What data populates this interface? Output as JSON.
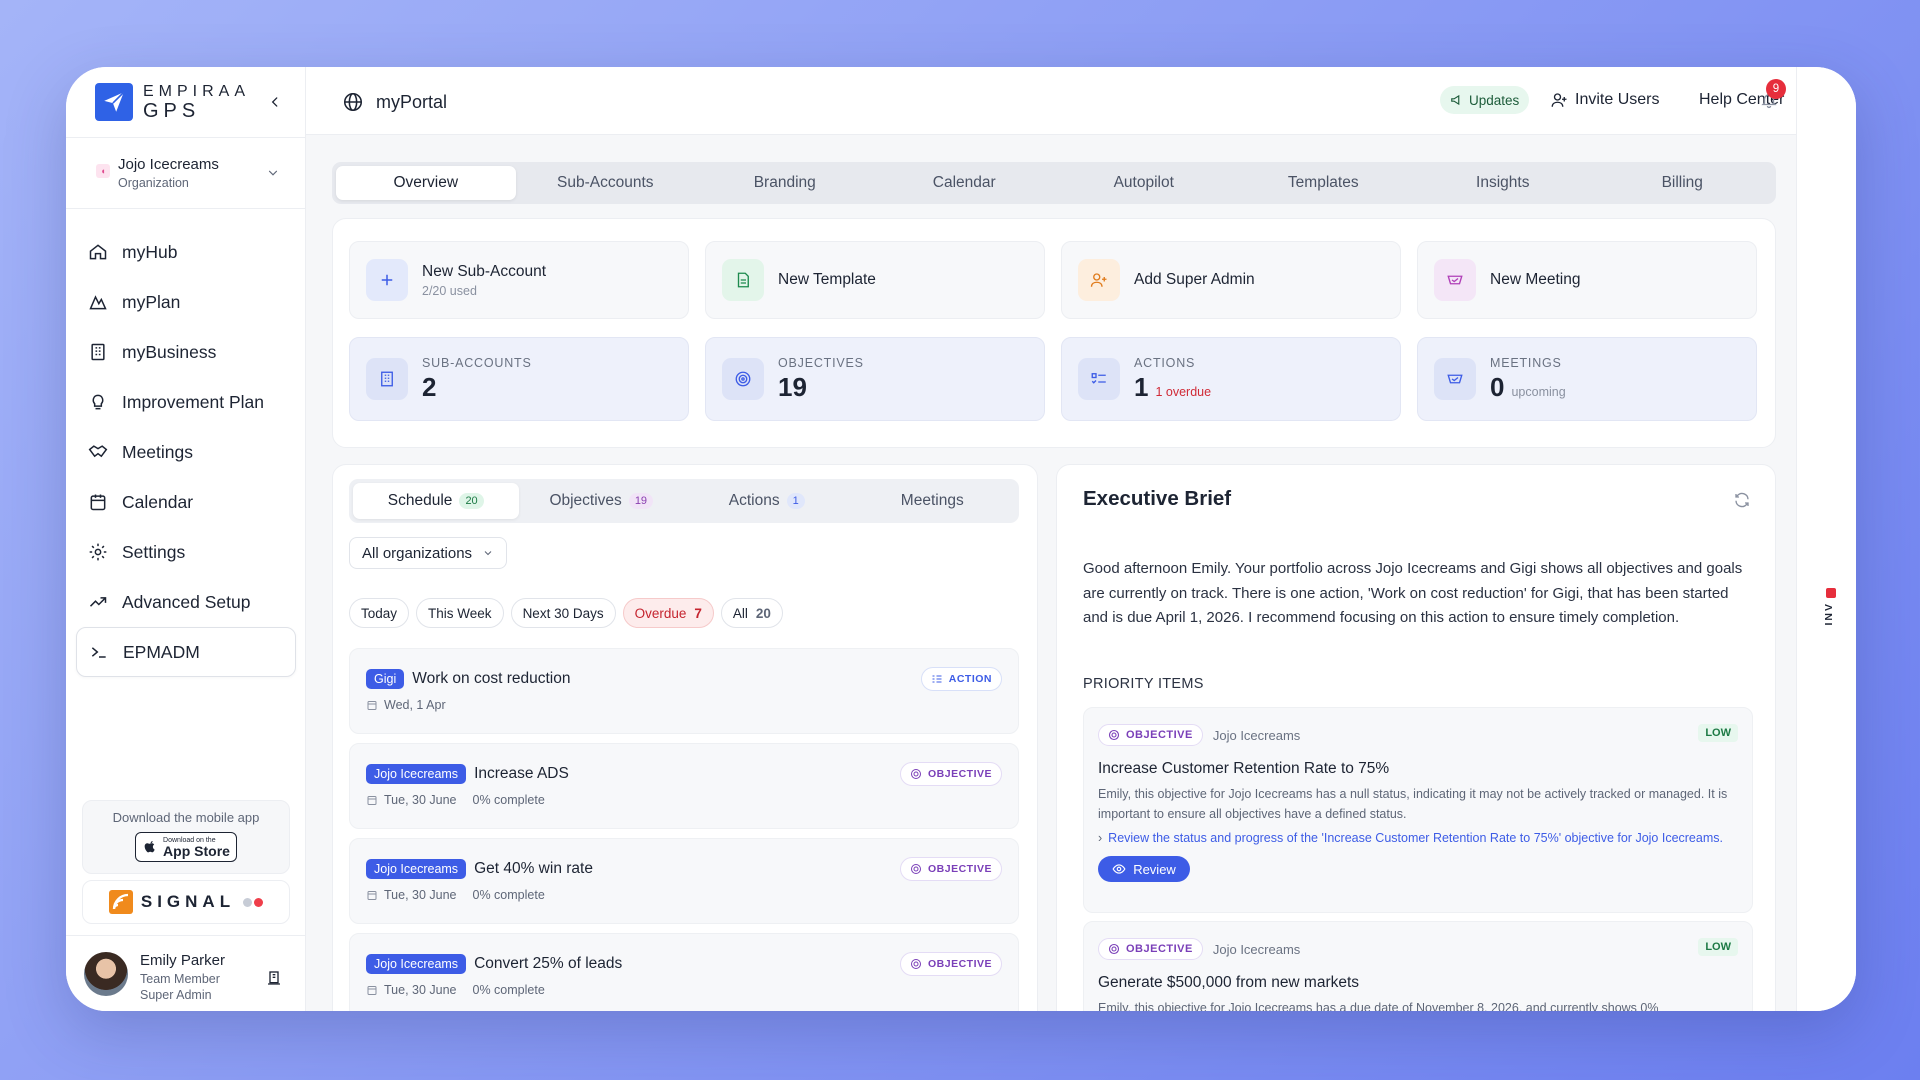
{
  "brand": {
    "line1": "EMPIRAA",
    "line2": "GPS"
  },
  "org": {
    "name": "Jojo Icecreams",
    "type": "Organization"
  },
  "nav": [
    {
      "label": "myHub",
      "icon": "home-icon"
    },
    {
      "label": "myPlan",
      "icon": "mountain-icon"
    },
    {
      "label": "myBusiness",
      "icon": "building-icon"
    },
    {
      "label": "Improvement Plan",
      "icon": "lightbulb-icon"
    },
    {
      "label": "Meetings",
      "icon": "handshake-icon"
    },
    {
      "label": "Calendar",
      "icon": "calendar-icon"
    },
    {
      "label": "Settings",
      "icon": "gear-icon"
    },
    {
      "label": "Advanced Setup",
      "icon": "trend-icon"
    },
    {
      "label": "EPMADM",
      "icon": "terminal-icon",
      "active": true
    }
  ],
  "promo": {
    "title": "Download the mobile app",
    "store_small": "Download on the",
    "store_big": "App Store"
  },
  "signal": {
    "word": "SIGNAL"
  },
  "user": {
    "name": "Emily Parker",
    "role1": "Team Member",
    "role2": "Super Admin"
  },
  "topbar": {
    "title": "myPortal",
    "updates": "Updates",
    "invite": "Invite Users",
    "help": "Help Center",
    "notif_count": "9"
  },
  "tabs": [
    "Overview",
    "Sub-Accounts",
    "Branding",
    "Calendar",
    "Autopilot",
    "Templates",
    "Insights",
    "Billing"
  ],
  "quick_actions": [
    {
      "title": "New Sub-Account",
      "sub": "2/20 used",
      "icon": "plus-icon"
    },
    {
      "title": "New Template",
      "sub": "",
      "icon": "document-icon"
    },
    {
      "title": "Add Super Admin",
      "sub": "",
      "icon": "user-plus-icon"
    },
    {
      "title": "New Meeting",
      "sub": "",
      "icon": "handshake-icon"
    }
  ],
  "stats": [
    {
      "label": "SUB-ACCOUNTS",
      "value": "2",
      "extra": "",
      "icon": "building-icon"
    },
    {
      "label": "OBJECTIVES",
      "value": "19",
      "extra": "",
      "icon": "target-icon"
    },
    {
      "label": "ACTIONS",
      "value": "1",
      "extra": "1 overdue",
      "icon": "checklist-icon"
    },
    {
      "label": "MEETINGS",
      "value": "0",
      "extra": "upcoming",
      "icon": "handshake-icon"
    }
  ],
  "schedule_tabs": [
    {
      "label": "Schedule",
      "count": "20"
    },
    {
      "label": "Objectives",
      "count": "19"
    },
    {
      "label": "Actions",
      "count": "1"
    },
    {
      "label": "Meetings",
      "count": ""
    }
  ],
  "filter": {
    "label": "All organizations"
  },
  "chips": [
    {
      "label": "Today",
      "count": ""
    },
    {
      "label": "This Week",
      "count": ""
    },
    {
      "label": "Next 30 Days",
      "count": ""
    },
    {
      "label": "Overdue",
      "count": "7"
    },
    {
      "label": "All",
      "count": "20"
    }
  ],
  "items": [
    {
      "org": "Gigi",
      "title": "Work on cost reduction",
      "date": "Wed, 1 Apr",
      "progress": "",
      "type": "ACTION"
    },
    {
      "org": "Jojo Icecreams",
      "title": "Increase ADS",
      "date": "Tue, 30 June",
      "progress": "0% complete",
      "type": "OBJECTIVE"
    },
    {
      "org": "Jojo Icecreams",
      "title": "Get 40% win rate",
      "date": "Tue, 30 June",
      "progress": "0% complete",
      "type": "OBJECTIVE"
    },
    {
      "org": "Jojo Icecreams",
      "title": "Convert 25% of leads",
      "date": "Tue, 30 June",
      "progress": "0% complete",
      "type": "OBJECTIVE"
    }
  ],
  "brief": {
    "title": "Executive Brief",
    "text": "Good afternoon Emily. Your portfolio across Jojo Icecreams and Gigi shows all objectives and goals are currently on track. There is one action, 'Work on cost reduction' for Gigi, that has been started and is due April 1, 2026. I recommend focusing on this action to ensure timely completion.",
    "priority_label": "PRIORITY ITEMS",
    "items": [
      {
        "tag": "OBJECTIVE",
        "org": "Jojo Icecreams",
        "level": "LOW",
        "title": "Increase Customer Retention Rate to 75%",
        "desc": "Emily, this objective for Jojo Icecreams has a null status, indicating it may not be actively tracked or managed. It is important to ensure all objectives have a defined status.",
        "link": "Review the status and progress of the 'Increase Customer Retention Rate to 75%' objective for Jojo Icecreams.",
        "button": "Review"
      },
      {
        "tag": "OBJECTIVE",
        "org": "Jojo Icecreams",
        "level": "LOW",
        "title": "Generate $500,000 from new markets",
        "desc": "Emily, this objective for Jojo Icecreams has a due date of November 8, 2026, and currently shows 0%",
        "link": "",
        "button": ""
      }
    ]
  },
  "side_label": "INV",
  "colors": {
    "accent": "#3d5ce6",
    "overdue": "#c5242f",
    "objective": "#7a3fb8",
    "success": "#1d7a45"
  }
}
